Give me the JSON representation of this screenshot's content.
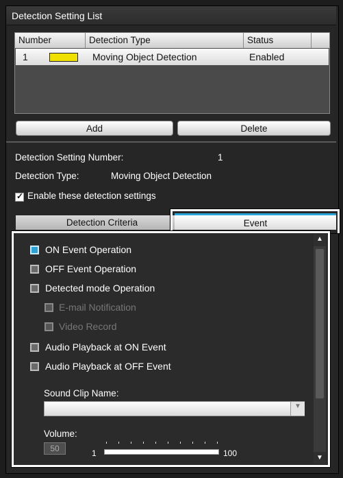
{
  "header": {
    "title": "Detection Setting List"
  },
  "table": {
    "columns": [
      "Number",
      "Detection Type",
      "Status"
    ],
    "rows": [
      {
        "number": "1",
        "type": "Moving Object Detection",
        "status": "Enabled",
        "color": "#f0e000"
      }
    ]
  },
  "buttons": {
    "add": "Add",
    "delete": "Delete"
  },
  "info": {
    "number_label": "Detection Setting Number:",
    "number_value": "1",
    "type_label": "Detection Type:",
    "type_value": "Moving Object Detection",
    "enable_label": "Enable these detection settings"
  },
  "tabs": {
    "criteria": "Detection Criteria",
    "event": "Event"
  },
  "event": {
    "on_event": "ON Event Operation",
    "off_event": "OFF Event Operation",
    "detected_mode": "Detected mode Operation",
    "email": "E-mail Notification",
    "video": "Video Record",
    "audio_on": "Audio Playback at ON Event",
    "audio_off": "Audio Playback at OFF Event",
    "sound_clip_label": "Sound Clip Name:",
    "volume_label": "Volume:",
    "volume_value": "50",
    "volume_min": "1",
    "volume_max": "100"
  },
  "colors": {
    "accent": "#2aa3d6",
    "swatch": "#f0e000"
  }
}
